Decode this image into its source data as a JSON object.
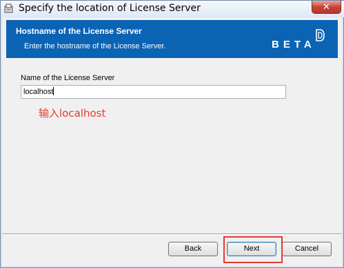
{
  "window": {
    "title": "Specify the location of License Server",
    "close_glyph": "✕"
  },
  "banner": {
    "title": "Hostname of the License Server",
    "subtitle": "Enter the hostname of the License Server.",
    "logo_text": "BETA",
    "background_color": "#0b63b4"
  },
  "form": {
    "server_label": "Name of the License Server",
    "server_value": "localhost"
  },
  "annotation": {
    "text": "输入localhost",
    "color": "#e8382c"
  },
  "buttons": {
    "back": "Back",
    "next": "Next",
    "cancel": "Cancel"
  },
  "icons": {
    "app": "installer-icon",
    "close": "close-icon",
    "logo": "beta-d-logo-icon"
  }
}
